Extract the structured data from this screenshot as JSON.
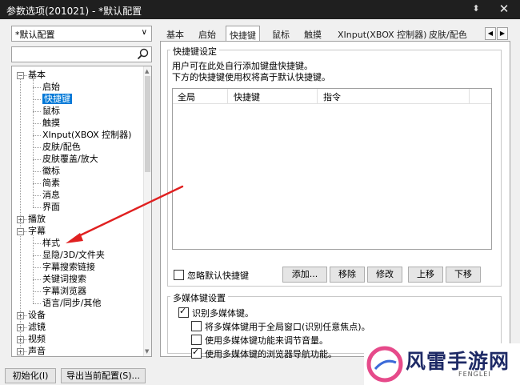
{
  "window": {
    "title": "参数选项(201021) - *默认配置",
    "pin_glyph": "⬍",
    "close_glyph": "✕"
  },
  "left": {
    "preset_value": "*默认配置",
    "search_placeholder": "",
    "tree": [
      {
        "label": "基本",
        "level": 0,
        "expanded": true
      },
      {
        "label": "启始",
        "level": 1
      },
      {
        "label": "快捷键",
        "level": 1,
        "selected": true
      },
      {
        "label": "鼠标",
        "level": 1
      },
      {
        "label": "触摸",
        "level": 1
      },
      {
        "label": "XInput(XBOX 控制器)",
        "level": 1
      },
      {
        "label": "皮肤/配色",
        "level": 1
      },
      {
        "label": "皮肤覆盖/放大",
        "level": 1
      },
      {
        "label": "徽标",
        "level": 1
      },
      {
        "label": "简素",
        "level": 1
      },
      {
        "label": "消息",
        "level": 1
      },
      {
        "label": "界面",
        "level": 1
      },
      {
        "label": "播放",
        "level": 0,
        "expanded": false
      },
      {
        "label": "字幕",
        "level": 0,
        "expanded": true
      },
      {
        "label": "样式",
        "level": 1
      },
      {
        "label": "显隐/3D/文件夹",
        "level": 1
      },
      {
        "label": "字幕搜索链接",
        "level": 1
      },
      {
        "label": "关键词搜索",
        "level": 1
      },
      {
        "label": "字幕浏览器",
        "level": 1
      },
      {
        "label": "语言/同步/其他",
        "level": 1
      },
      {
        "label": "设备",
        "level": 0,
        "expanded": false
      },
      {
        "label": "滤镜",
        "level": 0,
        "expanded": false
      },
      {
        "label": "视频",
        "level": 0,
        "expanded": false
      },
      {
        "label": "声音",
        "level": 0,
        "expanded": false
      }
    ]
  },
  "tabs": [
    {
      "label": "基本"
    },
    {
      "label": "启始"
    },
    {
      "label": "快捷键",
      "active": true
    },
    {
      "label": "鼠标"
    },
    {
      "label": "触摸"
    },
    {
      "label": "XInput(XBOX 控制器)"
    },
    {
      "label": "皮肤/配色"
    }
  ],
  "tab_nav": {
    "prev": "◀",
    "next": "▶"
  },
  "hotkeys": {
    "group_title": "快捷键设定",
    "desc_line1": "用户可在此处自行添加键盘快捷键。",
    "desc_line2": "下方的快捷键使用权将高于默认快捷键。",
    "columns": [
      "全局",
      "快捷键",
      "指令"
    ],
    "ignore_default_label": "忽略默认快捷键",
    "ignore_default_checked": false,
    "buttons": {
      "add": "添加...",
      "remove": "移除",
      "edit": "修改",
      "up": "上移",
      "down": "下移"
    }
  },
  "multimedia": {
    "group_title": "多媒体键设置",
    "recognize_label": "识别多媒体键。",
    "recognize_checked": true,
    "global_label": "将多媒体键用于全局窗口(识别任意焦点)。",
    "global_checked": false,
    "volume_label": "使用多媒体键功能来调节音量。",
    "volume_checked": false,
    "browser_label": "使用多媒体键的浏览器导航功能。",
    "browser_checked": true
  },
  "bottom": {
    "init_button": "初始化(I)",
    "export_button": "导出当前配置(S)..."
  },
  "watermark": {
    "text": "风雷手游网",
    "sub": "FENGLEI"
  },
  "colors": {
    "accent": "#0078d7",
    "annotation_arrow": "#e02020",
    "titlebar": "#1f1f1f"
  }
}
